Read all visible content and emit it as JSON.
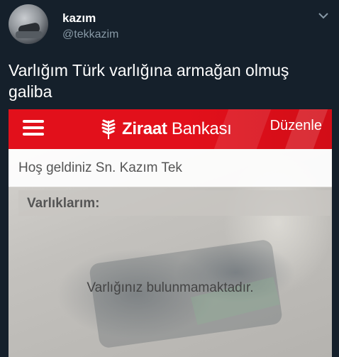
{
  "tweet": {
    "display_name": "kazım",
    "handle": "@tekkazim",
    "text": "Varlığım Türk varlığına armağan olmuş galiba",
    "menu_icon": "chevron-down-icon"
  },
  "screenshot": {
    "app": {
      "brand_bold": "Ziraat",
      "brand_regular": " Bankası",
      "edit_label": "Düzenle",
      "menu_icon": "hamburger-icon",
      "logo_icon": "wheat-logo-icon",
      "accent_color": "#e2101b"
    },
    "welcome_text": "Hoş geldiniz Sn. Kazım Tek",
    "section_title": "Varlıklarım:",
    "empty_message": "Varlığınız bulunmamaktadır."
  },
  "colors": {
    "background": "#15202b",
    "handle": "#8899a6",
    "brand_red": "#e2101b"
  }
}
